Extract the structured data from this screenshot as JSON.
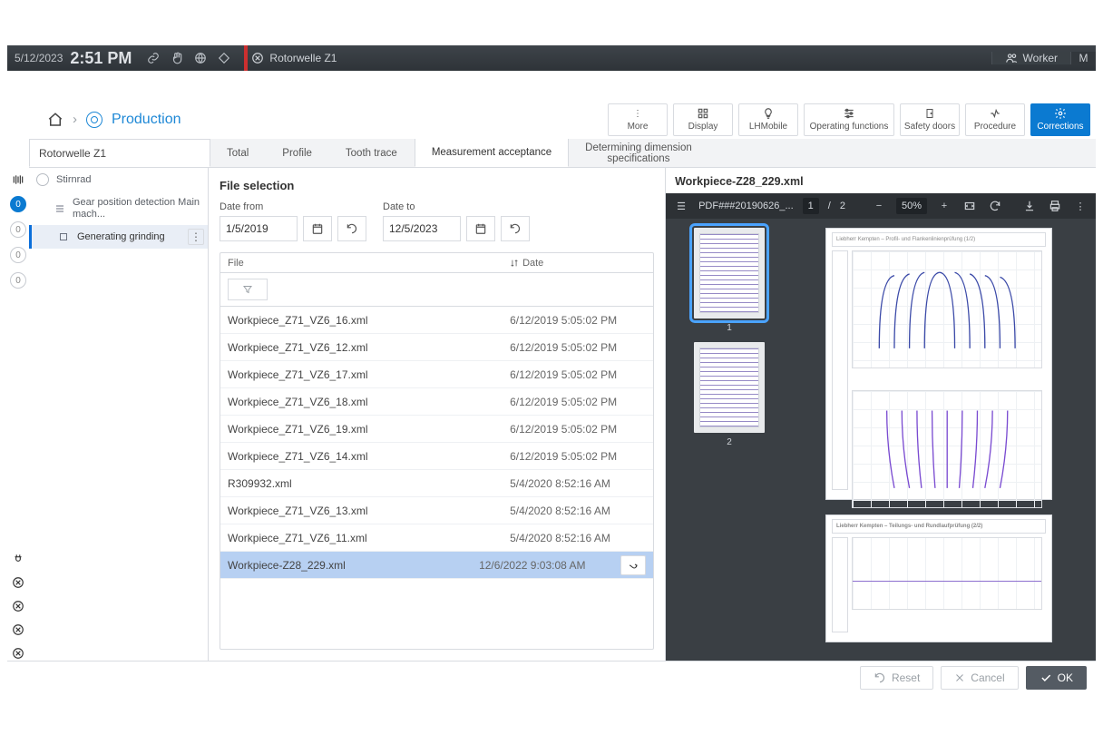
{
  "topbar": {
    "date": "5/12/2023",
    "time": "2:51 PM",
    "doc_title": "Rotorwelle Z1",
    "user_label": "Worker",
    "m": "M"
  },
  "breadcrumb": {
    "current": "Production"
  },
  "actions": [
    {
      "id": "more",
      "label": "More"
    },
    {
      "id": "display",
      "label": "Display"
    },
    {
      "id": "lhmobile",
      "label": "LHMobile"
    },
    {
      "id": "opfunc",
      "label": "Operating functions"
    },
    {
      "id": "safety",
      "label": "Safety doors"
    },
    {
      "id": "procedure",
      "label": "Procedure"
    },
    {
      "id": "corrections",
      "label": "Corrections"
    }
  ],
  "tabs": {
    "title": "Rotorwelle Z1",
    "items": [
      {
        "id": "total",
        "label": "Total"
      },
      {
        "id": "profile",
        "label": "Profile"
      },
      {
        "id": "tooth",
        "label": "Tooth trace"
      },
      {
        "id": "meas",
        "label": "Measurement acceptance",
        "selected": true
      },
      {
        "id": "dim",
        "label": "Determining dimension\nspecifications"
      }
    ]
  },
  "sidebar": {
    "items": [
      {
        "id": "stirnrad",
        "label": "Stirnrad"
      },
      {
        "id": "gearpos",
        "label": "Gear position detection Main mach..."
      },
      {
        "id": "gengrind",
        "label": "Generating grinding",
        "selected": true
      }
    ]
  },
  "rail_counts": [
    "0",
    "0",
    "0",
    "0"
  ],
  "file_panel": {
    "heading": "File selection",
    "from_label": "Date from",
    "to_label": "Date to",
    "from": "1/5/2019",
    "to": "12/5/2023",
    "col_file": "File",
    "col_date": "Date",
    "rows": [
      {
        "file": "Workpiece_Z71_VZ6_16.xml",
        "date": "6/12/2019 5:05:02 PM"
      },
      {
        "file": "Workpiece_Z71_VZ6_12.xml",
        "date": "6/12/2019 5:05:02 PM"
      },
      {
        "file": "Workpiece_Z71_VZ6_17.xml",
        "date": "6/12/2019 5:05:02 PM"
      },
      {
        "file": "Workpiece_Z71_VZ6_18.xml",
        "date": "6/12/2019 5:05:02 PM"
      },
      {
        "file": "Workpiece_Z71_VZ6_19.xml",
        "date": "6/12/2019 5:05:02 PM"
      },
      {
        "file": "Workpiece_Z71_VZ6_14.xml",
        "date": "6/12/2019 5:05:02 PM"
      },
      {
        "file": "R309932.xml",
        "date": "5/4/2020 8:52:16 AM"
      },
      {
        "file": "Workpiece_Z71_VZ6_13.xml",
        "date": "5/4/2020 8:52:16 AM"
      },
      {
        "file": "Workpiece_Z71_VZ6_11.xml",
        "date": "5/4/2020 8:52:16 AM"
      },
      {
        "file": "Workpiece-Z28_229.xml",
        "date": "12/6/2022 9:03:08 AM",
        "selected": true
      }
    ]
  },
  "preview": {
    "title": "Workpiece-Z28_229.xml",
    "pdf_name": "PDF###20190626_...",
    "page": "1",
    "pages": "2",
    "zoom": "50%",
    "page1_header": "Liebherr Kempten – Profil- und Flankenlinienprüfung (1/2)",
    "page2_header": "Liebherr Kempten – Teilungs- und Rundlaufprüfung (2/2)",
    "thumb_labels": [
      "1",
      "2"
    ]
  },
  "footer": {
    "reset": "Reset",
    "cancel": "Cancel",
    "ok": "OK"
  }
}
